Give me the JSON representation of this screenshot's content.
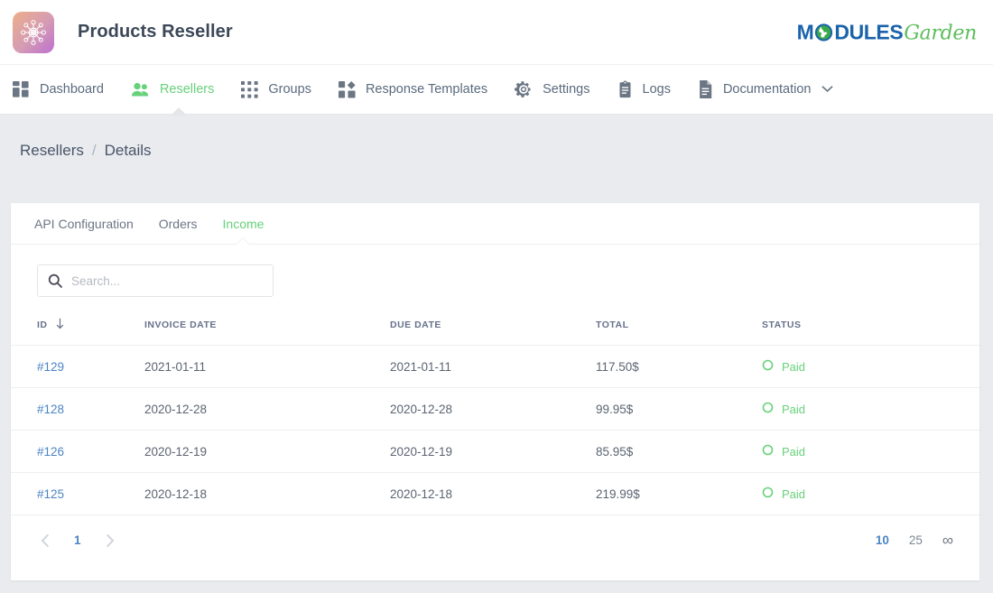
{
  "header": {
    "app_title": "Products Reseller",
    "logo_icon": "network-hub-icon",
    "brand": {
      "primary": "M",
      "primary_rest": "DULES",
      "secondary": "Garden",
      "globe_icon": "globe-icon"
    }
  },
  "nav": {
    "items": [
      {
        "label": "Dashboard",
        "icon": "grid-blocks-icon",
        "active": false
      },
      {
        "label": "Resellers",
        "icon": "people-icon",
        "active": true
      },
      {
        "label": "Groups",
        "icon": "dot-grid-icon",
        "active": false
      },
      {
        "label": "Response Templates",
        "icon": "squares-diamond-icon",
        "active": false
      },
      {
        "label": "Settings",
        "icon": "gear-icon",
        "active": false
      },
      {
        "label": "Logs",
        "icon": "clipboard-icon",
        "active": false
      },
      {
        "label": "Documentation",
        "icon": "document-icon",
        "active": false,
        "chevron": "chevron-down-icon"
      }
    ]
  },
  "breadcrumb": {
    "parent": "Resellers",
    "separator": "/",
    "current": "Details"
  },
  "tabs": [
    {
      "label": "API Configuration",
      "active": false
    },
    {
      "label": "Orders",
      "active": false
    },
    {
      "label": "Income",
      "active": true
    }
  ],
  "search": {
    "placeholder": "Search...",
    "value": "",
    "icon": "search-icon"
  },
  "table": {
    "columns": [
      {
        "key": "id",
        "label": "ID",
        "sort": "sort-desc-arrow-icon"
      },
      {
        "key": "invoice_date",
        "label": "INVOICE DATE"
      },
      {
        "key": "due_date",
        "label": "DUE DATE"
      },
      {
        "key": "total",
        "label": "TOTAL"
      },
      {
        "key": "status",
        "label": "STATUS"
      }
    ],
    "rows": [
      {
        "id": "#129",
        "invoice_date": "2021-01-11",
        "due_date": "2021-01-11",
        "total": "117.50$",
        "status": "Paid",
        "status_icon": "circle-outline-icon"
      },
      {
        "id": "#128",
        "invoice_date": "2020-12-28",
        "due_date": "2020-12-28",
        "total": "99.95$",
        "status": "Paid",
        "status_icon": "circle-outline-icon"
      },
      {
        "id": "#126",
        "invoice_date": "2020-12-19",
        "due_date": "2020-12-19",
        "total": "85.95$",
        "status": "Paid",
        "status_icon": "circle-outline-icon"
      },
      {
        "id": "#125",
        "invoice_date": "2020-12-18",
        "due_date": "2020-12-18",
        "total": "219.99$",
        "status": "Paid",
        "status_icon": "circle-outline-icon"
      }
    ]
  },
  "pagination": {
    "prev_icon": "chevron-left-icon",
    "next_icon": "chevron-right-icon",
    "pages": [
      "1"
    ],
    "current_page": "1",
    "page_sizes": [
      "10",
      "25",
      "∞"
    ],
    "active_page_size": "10"
  },
  "colors": {
    "accent_green": "#66d17a",
    "link_blue": "#4c84c4",
    "text_dark": "#3c4858",
    "page_bg": "#e9ebef",
    "brand_blue": "#1b63ab",
    "brand_green": "#5cbd5c"
  }
}
